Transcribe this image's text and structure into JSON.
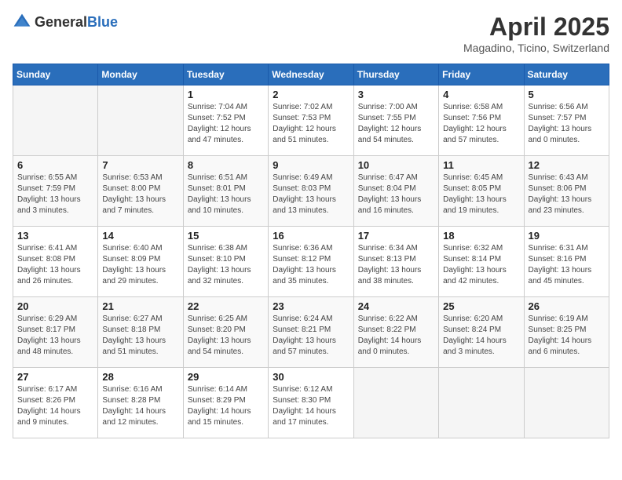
{
  "logo": {
    "text_general": "General",
    "text_blue": "Blue"
  },
  "header": {
    "month_year": "April 2025",
    "location": "Magadino, Ticino, Switzerland"
  },
  "weekdays": [
    "Sunday",
    "Monday",
    "Tuesday",
    "Wednesday",
    "Thursday",
    "Friday",
    "Saturday"
  ],
  "weeks": [
    [
      {
        "day": "",
        "info": ""
      },
      {
        "day": "",
        "info": ""
      },
      {
        "day": "1",
        "info": "Sunrise: 7:04 AM\nSunset: 7:52 PM\nDaylight: 12 hours\nand 47 minutes."
      },
      {
        "day": "2",
        "info": "Sunrise: 7:02 AM\nSunset: 7:53 PM\nDaylight: 12 hours\nand 51 minutes."
      },
      {
        "day": "3",
        "info": "Sunrise: 7:00 AM\nSunset: 7:55 PM\nDaylight: 12 hours\nand 54 minutes."
      },
      {
        "day": "4",
        "info": "Sunrise: 6:58 AM\nSunset: 7:56 PM\nDaylight: 12 hours\nand 57 minutes."
      },
      {
        "day": "5",
        "info": "Sunrise: 6:56 AM\nSunset: 7:57 PM\nDaylight: 13 hours\nand 0 minutes."
      }
    ],
    [
      {
        "day": "6",
        "info": "Sunrise: 6:55 AM\nSunset: 7:59 PM\nDaylight: 13 hours\nand 3 minutes."
      },
      {
        "day": "7",
        "info": "Sunrise: 6:53 AM\nSunset: 8:00 PM\nDaylight: 13 hours\nand 7 minutes."
      },
      {
        "day": "8",
        "info": "Sunrise: 6:51 AM\nSunset: 8:01 PM\nDaylight: 13 hours\nand 10 minutes."
      },
      {
        "day": "9",
        "info": "Sunrise: 6:49 AM\nSunset: 8:03 PM\nDaylight: 13 hours\nand 13 minutes."
      },
      {
        "day": "10",
        "info": "Sunrise: 6:47 AM\nSunset: 8:04 PM\nDaylight: 13 hours\nand 16 minutes."
      },
      {
        "day": "11",
        "info": "Sunrise: 6:45 AM\nSunset: 8:05 PM\nDaylight: 13 hours\nand 19 minutes."
      },
      {
        "day": "12",
        "info": "Sunrise: 6:43 AM\nSunset: 8:06 PM\nDaylight: 13 hours\nand 23 minutes."
      }
    ],
    [
      {
        "day": "13",
        "info": "Sunrise: 6:41 AM\nSunset: 8:08 PM\nDaylight: 13 hours\nand 26 minutes."
      },
      {
        "day": "14",
        "info": "Sunrise: 6:40 AM\nSunset: 8:09 PM\nDaylight: 13 hours\nand 29 minutes."
      },
      {
        "day": "15",
        "info": "Sunrise: 6:38 AM\nSunset: 8:10 PM\nDaylight: 13 hours\nand 32 minutes."
      },
      {
        "day": "16",
        "info": "Sunrise: 6:36 AM\nSunset: 8:12 PM\nDaylight: 13 hours\nand 35 minutes."
      },
      {
        "day": "17",
        "info": "Sunrise: 6:34 AM\nSunset: 8:13 PM\nDaylight: 13 hours\nand 38 minutes."
      },
      {
        "day": "18",
        "info": "Sunrise: 6:32 AM\nSunset: 8:14 PM\nDaylight: 13 hours\nand 42 minutes."
      },
      {
        "day": "19",
        "info": "Sunrise: 6:31 AM\nSunset: 8:16 PM\nDaylight: 13 hours\nand 45 minutes."
      }
    ],
    [
      {
        "day": "20",
        "info": "Sunrise: 6:29 AM\nSunset: 8:17 PM\nDaylight: 13 hours\nand 48 minutes."
      },
      {
        "day": "21",
        "info": "Sunrise: 6:27 AM\nSunset: 8:18 PM\nDaylight: 13 hours\nand 51 minutes."
      },
      {
        "day": "22",
        "info": "Sunrise: 6:25 AM\nSunset: 8:20 PM\nDaylight: 13 hours\nand 54 minutes."
      },
      {
        "day": "23",
        "info": "Sunrise: 6:24 AM\nSunset: 8:21 PM\nDaylight: 13 hours\nand 57 minutes."
      },
      {
        "day": "24",
        "info": "Sunrise: 6:22 AM\nSunset: 8:22 PM\nDaylight: 14 hours\nand 0 minutes."
      },
      {
        "day": "25",
        "info": "Sunrise: 6:20 AM\nSunset: 8:24 PM\nDaylight: 14 hours\nand 3 minutes."
      },
      {
        "day": "26",
        "info": "Sunrise: 6:19 AM\nSunset: 8:25 PM\nDaylight: 14 hours\nand 6 minutes."
      }
    ],
    [
      {
        "day": "27",
        "info": "Sunrise: 6:17 AM\nSunset: 8:26 PM\nDaylight: 14 hours\nand 9 minutes."
      },
      {
        "day": "28",
        "info": "Sunrise: 6:16 AM\nSunset: 8:28 PM\nDaylight: 14 hours\nand 12 minutes."
      },
      {
        "day": "29",
        "info": "Sunrise: 6:14 AM\nSunset: 8:29 PM\nDaylight: 14 hours\nand 15 minutes."
      },
      {
        "day": "30",
        "info": "Sunrise: 6:12 AM\nSunset: 8:30 PM\nDaylight: 14 hours\nand 17 minutes."
      },
      {
        "day": "",
        "info": ""
      },
      {
        "day": "",
        "info": ""
      },
      {
        "day": "",
        "info": ""
      }
    ]
  ]
}
